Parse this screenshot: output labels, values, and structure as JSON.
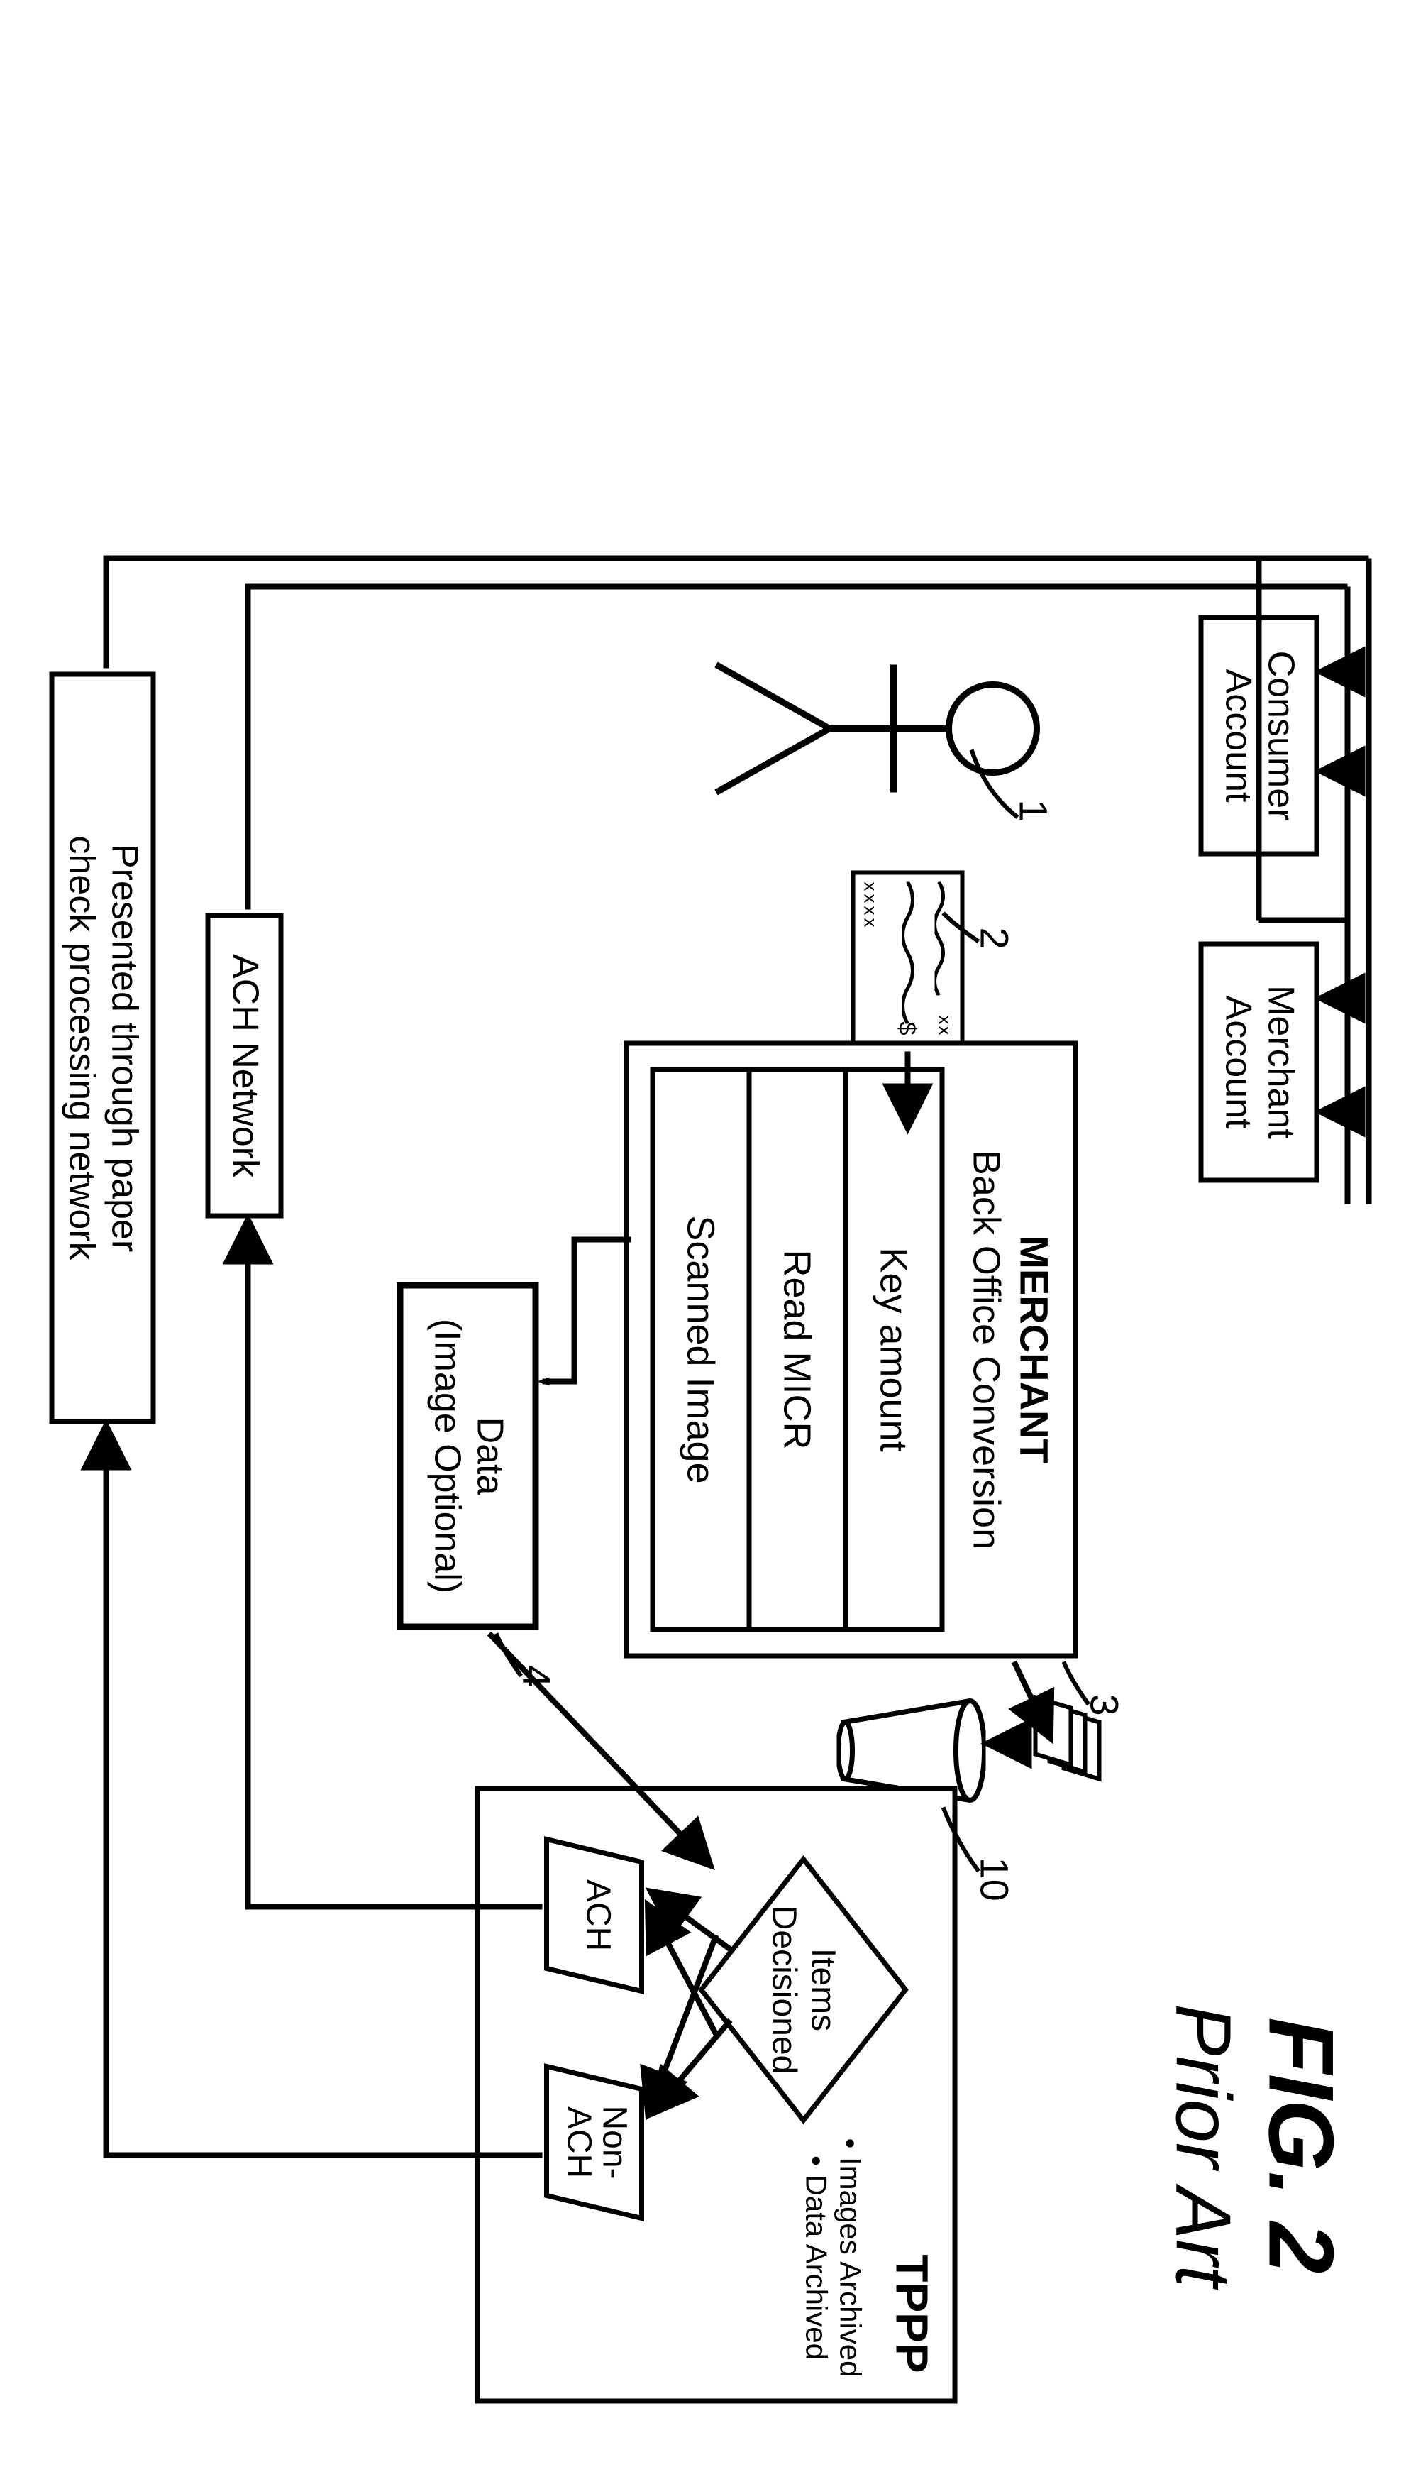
{
  "figure": {
    "number": "FIG. 2",
    "caption": "Prior Art"
  },
  "accounts": {
    "consumer": "Consumer\nAccount",
    "merchant": "Merchant\nAccount"
  },
  "merchant_box": {
    "title": "MERCHANT",
    "subtitle": "Back Office Conversion",
    "rows": [
      "Key amount",
      "Read MICR",
      "Scanned Image"
    ]
  },
  "data_box": {
    "line1": "Data",
    "line2": "(Image Optional)"
  },
  "tppp": {
    "title": "TPPP",
    "decision": "Items\nDecisioned",
    "out_ach": "ACH",
    "out_nonach": "Non-\nACH",
    "bullets": [
      "Images Archived",
      "Data Archived"
    ]
  },
  "ach_network": "ACH Network",
  "paper_network": "Presented through paper\ncheck processing network",
  "check": {
    "topright": "xx",
    "currency": "$",
    "bottom": "xxxx"
  },
  "refs": {
    "r1": "1",
    "r2": "2",
    "r3": "3",
    "r4": "4",
    "r10": "10"
  }
}
